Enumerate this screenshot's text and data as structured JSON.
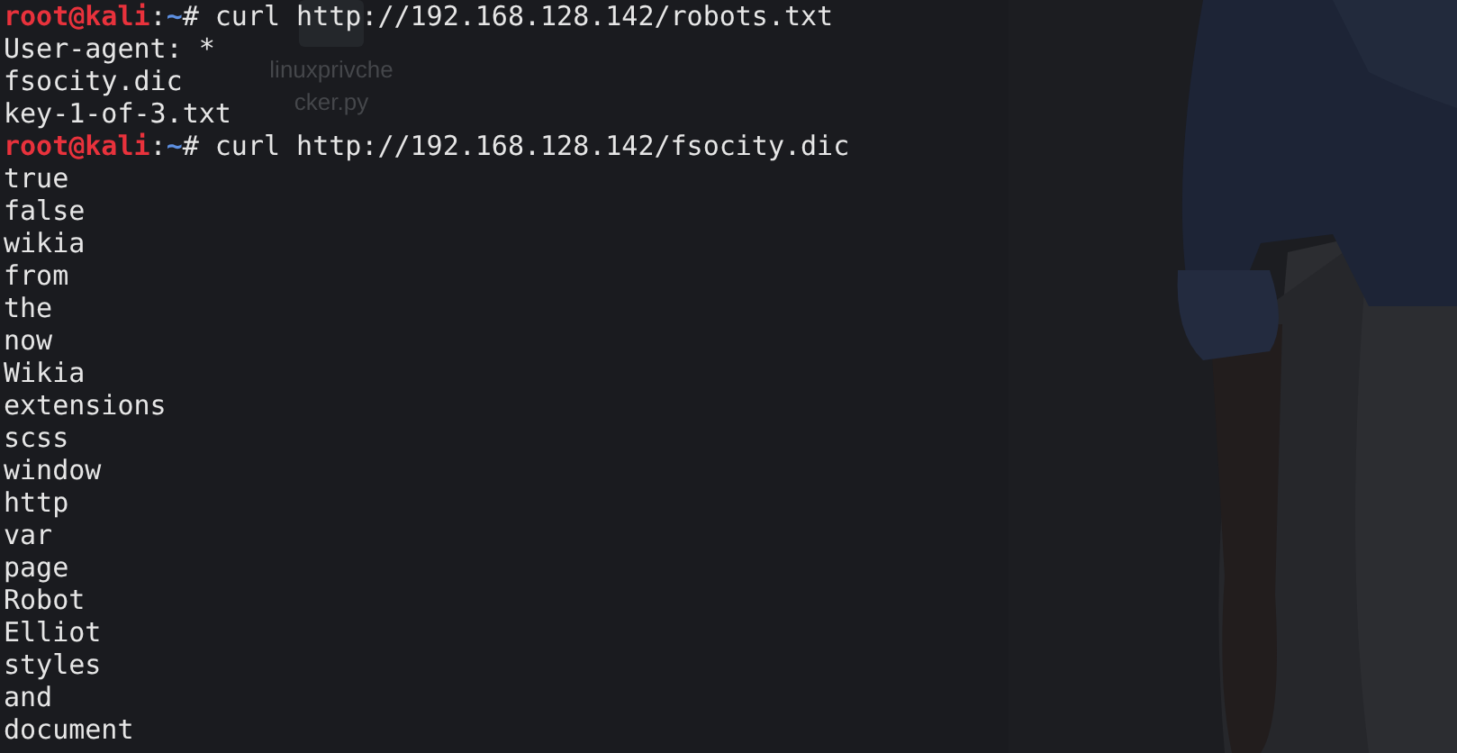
{
  "desktop_icon": {
    "label": "linuxprivchecker.py"
  },
  "terminal": {
    "lines": [
      {
        "kind": "prompt",
        "user": "root@kali",
        "separator": ":",
        "path": "~",
        "symbol": "#",
        "command": "curl http://192.168.128.142/robots.txt"
      },
      {
        "kind": "output",
        "text": "User-agent: *"
      },
      {
        "kind": "output",
        "text": "fsocity.dic"
      },
      {
        "kind": "output",
        "text": "key-1-of-3.txt"
      },
      {
        "kind": "prompt",
        "user": "root@kali",
        "separator": ":",
        "path": "~",
        "symbol": "#",
        "command": "curl http://192.168.128.142/fsocity.dic"
      },
      {
        "kind": "output",
        "text": "true"
      },
      {
        "kind": "output",
        "text": "false"
      },
      {
        "kind": "output",
        "text": "wikia"
      },
      {
        "kind": "output",
        "text": "from"
      },
      {
        "kind": "output",
        "text": "the"
      },
      {
        "kind": "output",
        "text": "now"
      },
      {
        "kind": "output",
        "text": "Wikia"
      },
      {
        "kind": "output",
        "text": "extensions"
      },
      {
        "kind": "output",
        "text": "scss"
      },
      {
        "kind": "output",
        "text": "window"
      },
      {
        "kind": "output",
        "text": "http"
      },
      {
        "kind": "output",
        "text": "var"
      },
      {
        "kind": "output",
        "text": "page"
      },
      {
        "kind": "output",
        "text": "Robot"
      },
      {
        "kind": "output",
        "text": "Elliot"
      },
      {
        "kind": "output",
        "text": "styles"
      },
      {
        "kind": "output",
        "text": "and"
      },
      {
        "kind": "output",
        "text": "document"
      }
    ]
  }
}
